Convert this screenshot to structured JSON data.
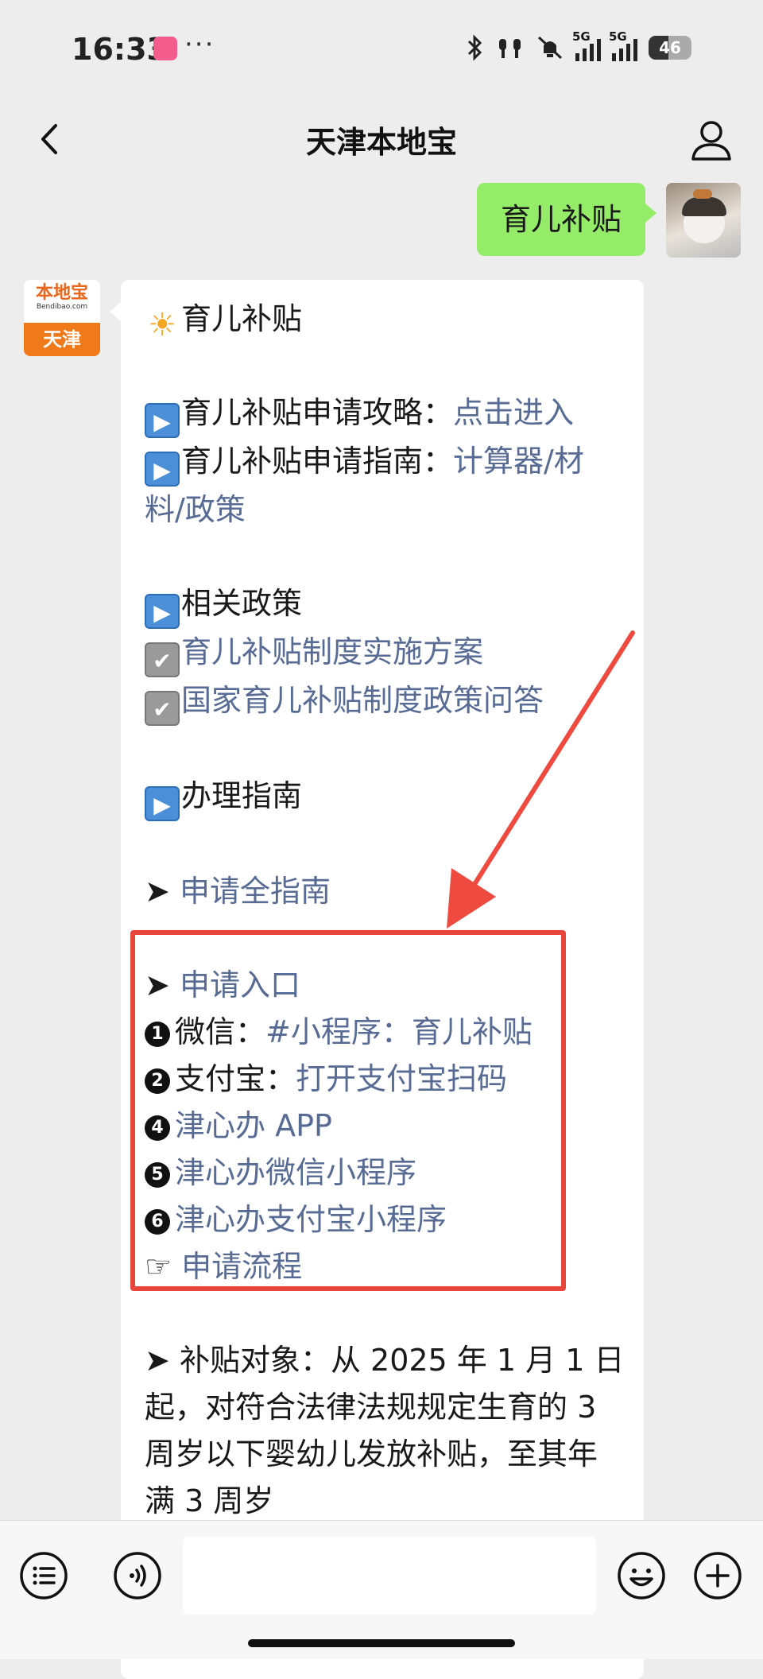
{
  "status": {
    "time": "16:33",
    "dots": "···",
    "net1": "5G",
    "net2": "5G",
    "battery": "46"
  },
  "nav": {
    "title": "天津本地宝"
  },
  "chat": {
    "my_message": "育儿补贴",
    "bot_avatar": {
      "brand": "本地宝",
      "site": "Bendibao.com",
      "city": "天津"
    },
    "message": {
      "heading": "育儿补贴",
      "l1_text": "育儿补贴申请攻略：",
      "l1_link": "点击进入",
      "l2_text": "育儿补贴申请指南：",
      "l2_link_a": "计算器/材",
      "l2_link_b": "料/政策",
      "policy_heading": "相关政策",
      "policy_1": "育儿补贴制度实施方案",
      "policy_2": "国家育儿补贴制度政策问答",
      "guide_heading": "办理指南",
      "arrow_symbol": "➤",
      "full_guide": "申请全指南",
      "entry_heading": "申请入口",
      "entry_1_num": "1",
      "entry_1_label": "微信：",
      "entry_1_link": "#小程序：育儿补贴",
      "entry_2_num": "2",
      "entry_2_label": "支付宝：",
      "entry_2_link": "打开支付宝扫码",
      "entry_4_num": "4",
      "entry_4_link": "津心办 APP",
      "entry_5_num": "5",
      "entry_5_link": "津心办微信小程序",
      "entry_6_num": "6",
      "entry_6_link": "津心办支付宝小程序",
      "hand_symbol": "☞",
      "flow_link": "申请流程",
      "target_l1": "补贴对象：从 2025 年 1 月 1 日",
      "target_l2": "起，对符合法律法规规定生育的 3",
      "target_l3": "周岁以下婴幼儿发放补贴，至其年",
      "target_l4": "满 3 周岁"
    }
  },
  "colors": {
    "link": "#576b95",
    "my_bubble": "#95ec69",
    "highlight": "#e8453c"
  },
  "icons": [
    "back-icon",
    "profile-icon",
    "list-icon",
    "voice-icon",
    "emoji-icon",
    "plus-icon"
  ]
}
